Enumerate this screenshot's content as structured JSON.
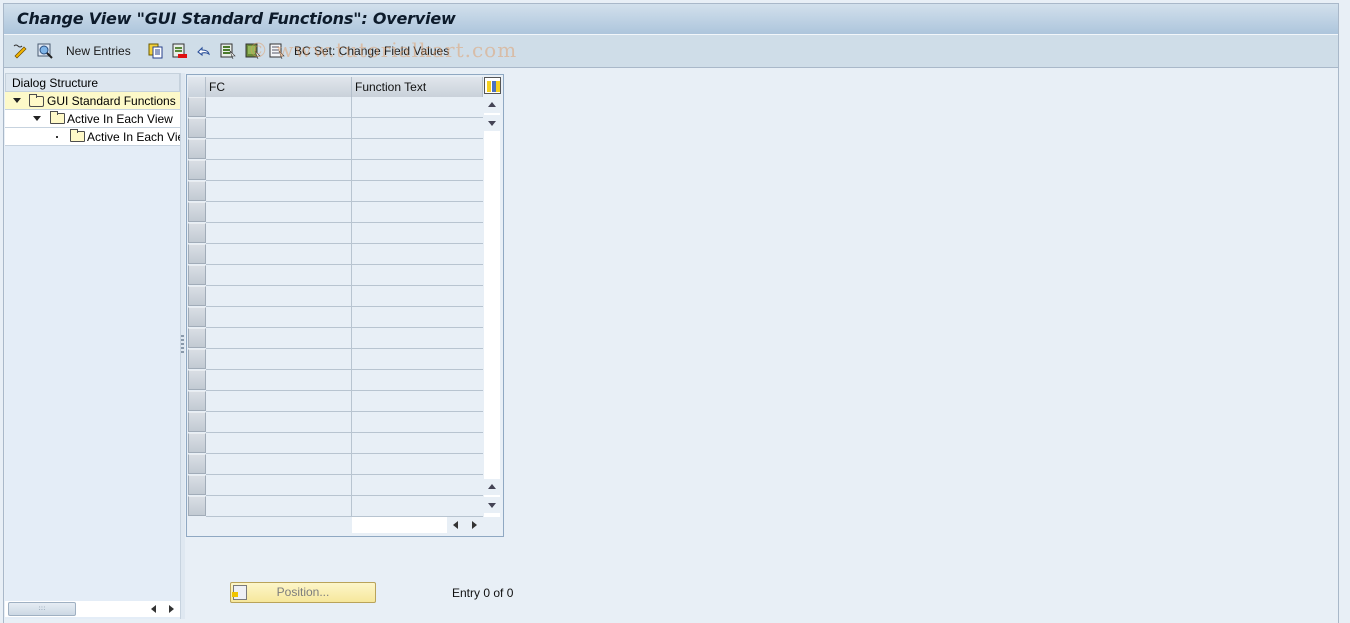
{
  "window": {
    "title": "Change View \"GUI Standard Functions\": Overview"
  },
  "toolbar": {
    "items": [
      {
        "icon": "display-change-icon",
        "label": ""
      },
      {
        "icon": "find-icon",
        "label": ""
      },
      {
        "icon": "",
        "label": "New Entries"
      },
      {
        "icon": "copy-as-icon",
        "label": ""
      },
      {
        "icon": "delete-icon",
        "label": ""
      },
      {
        "icon": "undo-change-icon",
        "label": ""
      },
      {
        "icon": "select-all-icon",
        "label": ""
      },
      {
        "icon": "select-block-icon",
        "label": ""
      },
      {
        "icon": "deselect-all-icon",
        "label": ""
      },
      {
        "icon": "",
        "label": "BC Set: Change Field Values"
      }
    ],
    "watermark": "© www.tutorialkart.com"
  },
  "dialog_structure": {
    "header": "Dialog Structure",
    "nodes": [
      {
        "label": "GUI Standard Functions",
        "level": 0,
        "expanded": true,
        "selected": true
      },
      {
        "label": "Active In Each View",
        "level": 1,
        "expanded": true,
        "selected": false
      },
      {
        "label": "Active In Each View",
        "level": 2,
        "expanded": false,
        "selected": false
      }
    ],
    "scroll_thumb": ":::"
  },
  "table": {
    "columns": [
      "FC",
      "Function Text"
    ],
    "rows": [
      [
        "",
        ""
      ],
      [
        "",
        ""
      ],
      [
        "",
        ""
      ],
      [
        "",
        ""
      ],
      [
        "",
        ""
      ],
      [
        "",
        ""
      ],
      [
        "",
        ""
      ],
      [
        "",
        ""
      ],
      [
        "",
        ""
      ],
      [
        "",
        ""
      ],
      [
        "",
        ""
      ],
      [
        "",
        ""
      ],
      [
        "",
        ""
      ],
      [
        "",
        ""
      ],
      [
        "",
        ""
      ],
      [
        "",
        ""
      ],
      [
        "",
        ""
      ],
      [
        "",
        ""
      ],
      [
        "",
        ""
      ],
      [
        "",
        ""
      ]
    ]
  },
  "footer": {
    "position_button": "Position...",
    "entry_text": "Entry 0 of 0"
  },
  "colors": {
    "title_gradient_top": "#d2e0ec",
    "title_gradient_bottom": "#adc5dc",
    "toolbar_bg": "#cfdde8",
    "selected_node_bg": "#fdf9c9",
    "button_yellow": "#f6e79c"
  }
}
